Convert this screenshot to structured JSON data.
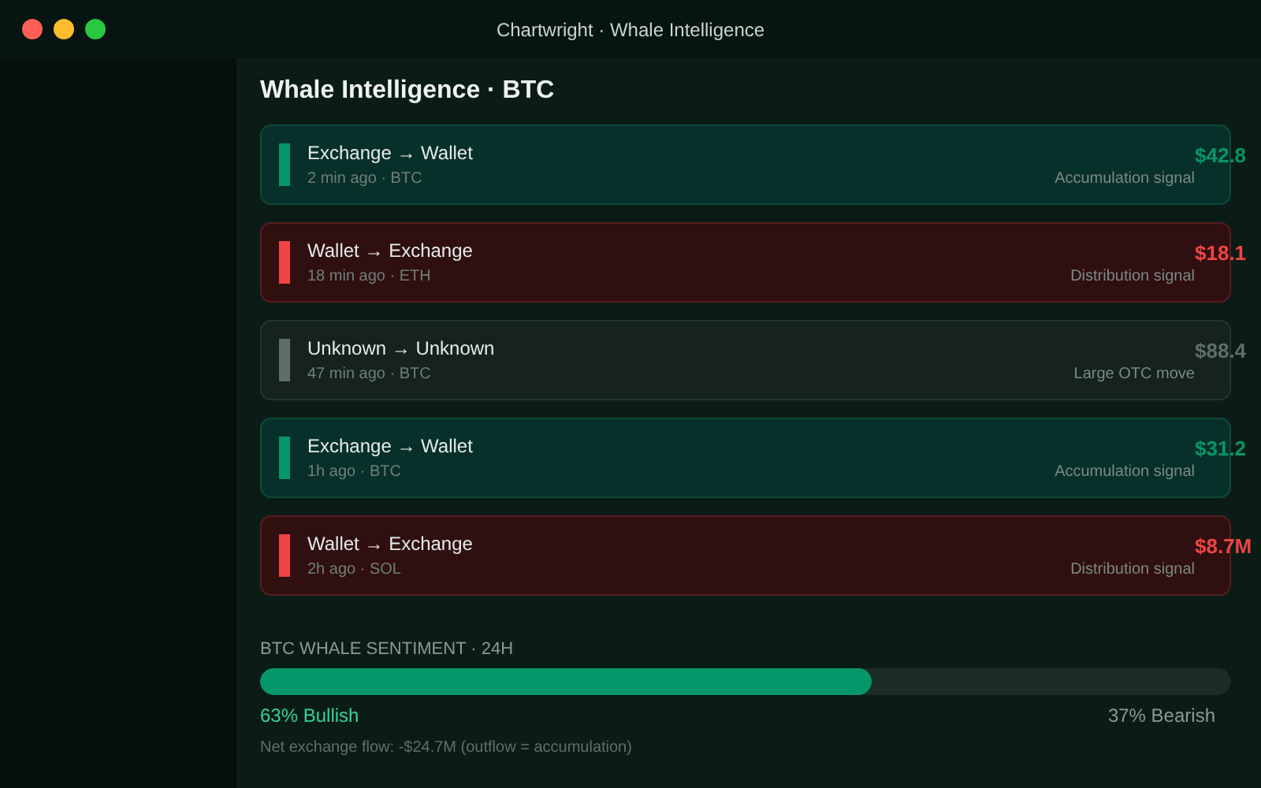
{
  "window": {
    "title": "Chartwright · Whale Intelligence"
  },
  "heading": "Whale Intelligence · BTC",
  "transfers": [
    {
      "kind": "inflow",
      "route": "Exchange → Wallet",
      "meta": "2 min ago · BTC",
      "amount": "$42.8",
      "signal": "Accumulation signal"
    },
    {
      "kind": "outflow",
      "route": "Wallet → Exchange",
      "meta": "18 min ago · ETH",
      "amount": "$18.1",
      "signal": "Distribution signal"
    },
    {
      "kind": "neutral",
      "route": "Unknown → Unknown",
      "meta": "47 min ago · BTC",
      "amount": "$88.4",
      "signal": "Large OTC move"
    },
    {
      "kind": "inflow",
      "route": "Exchange → Wallet",
      "meta": "1h ago · BTC",
      "amount": "$31.2",
      "signal": "Accumulation signal"
    },
    {
      "kind": "outflow",
      "route": "Wallet → Exchange",
      "meta": "2h ago · SOL",
      "amount": "$8.7M",
      "signal": "Distribution signal"
    }
  ],
  "sentiment": {
    "label": "BTC WHALE SENTIMENT · 24H",
    "level": 0.63,
    "bullish": "63% Bullish",
    "bearish": "37% Bearish",
    "note": "Net exchange flow: -$24.7M (outflow = accumulation)"
  }
}
